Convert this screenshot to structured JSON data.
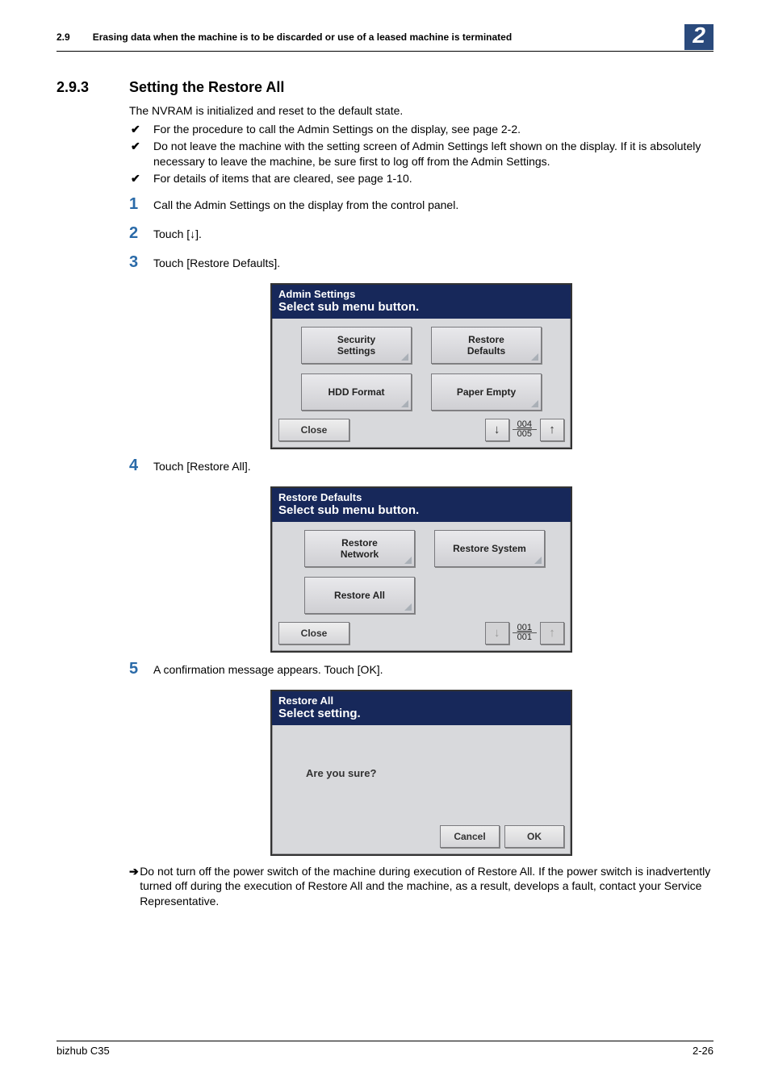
{
  "header": {
    "section_num": "2.9",
    "title": "Erasing data when the machine is to be discarded or use of a leased machine is terminated",
    "chapter": "2"
  },
  "section": {
    "num": "2.9.3",
    "title": "Setting the Restore All"
  },
  "intro": "The NVRAM is initialized and reset to the default state.",
  "checks": [
    "For the procedure to call the Admin Settings on the display, see page 2-2.",
    "Do not leave the machine with the setting screen of Admin Settings left shown on the display. If it is absolutely necessary to leave the machine, be sure first to log off from the Admin Settings.",
    "For details of items that are cleared, see page 1-10."
  ],
  "steps": {
    "s1": {
      "num": "1",
      "text": "Call the Admin Settings on the display from the control panel."
    },
    "s2": {
      "num": "2",
      "text": "Touch [↓]."
    },
    "s3": {
      "num": "3",
      "text": "Touch [Restore Defaults]."
    },
    "s4": {
      "num": "4",
      "text": "Touch [Restore All]."
    },
    "s5": {
      "num": "5",
      "text": "A confirmation message appears. Touch [OK]."
    }
  },
  "panel1": {
    "title": "Admin Settings",
    "sub": "Select sub menu button.",
    "buttons": {
      "b1": "Security\nSettings",
      "b2": "Restore\nDefaults",
      "b3": "HDD Format",
      "b4": "Paper Empty"
    },
    "close": "Close",
    "counter_top": "004",
    "counter_bot": "005"
  },
  "panel2": {
    "title": "Restore Defaults",
    "sub": "Select sub menu button.",
    "buttons": {
      "b1": "Restore\nNetwork",
      "b2": "Restore System",
      "b3": "Restore All"
    },
    "close": "Close",
    "counter_top": "001",
    "counter_bot": "001"
  },
  "panel3": {
    "title": "Restore All",
    "sub": "Select setting.",
    "message": "Are you sure?",
    "cancel": "Cancel",
    "ok": "OK"
  },
  "note": "Do not turn off the power switch of the machine during execution of Restore All. If the power switch is inadvertently turned off during the execution of Restore All and the machine, as a result, develops a fault, contact your Service Representative.",
  "footer": {
    "left": "bizhub C35",
    "right": "2-26"
  }
}
